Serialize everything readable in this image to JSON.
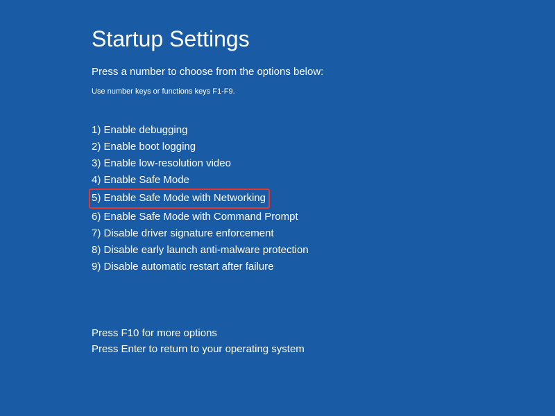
{
  "title": "Startup Settings",
  "subtitle": "Press a number to choose from the options below:",
  "hint": "Use number keys or functions keys F1-F9.",
  "options": [
    "1) Enable debugging",
    "2) Enable boot logging",
    "3) Enable low-resolution video",
    "4) Enable Safe Mode",
    "5) Enable Safe Mode with Networking",
    "6) Enable Safe Mode with Command Prompt",
    "7) Disable driver signature enforcement",
    "8) Disable early launch anti-malware protection",
    "9) Disable automatic restart after failure"
  ],
  "highlighted_index": 4,
  "footer": {
    "line1": "Press F10 for more options",
    "line2": "Press Enter to return to your operating system"
  },
  "colors": {
    "background": "#1a5ba6",
    "text": "#ffffff",
    "highlight_border": "#e8362c"
  }
}
